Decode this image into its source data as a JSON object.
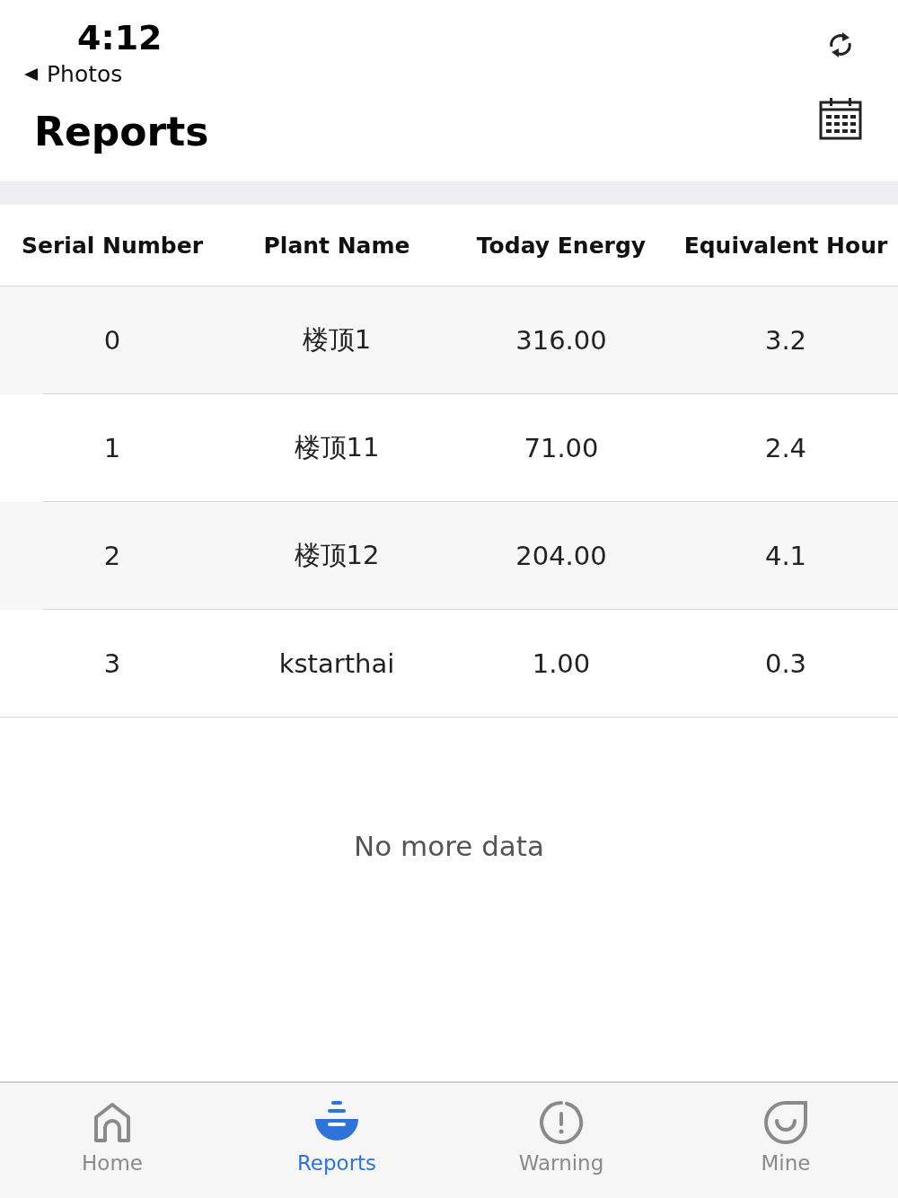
{
  "status_bar": {
    "time": "4:12",
    "back_label": "Photos"
  },
  "header": {
    "title": "Reports"
  },
  "table": {
    "columns": [
      "Serial Number",
      "Plant Name",
      "Today Energy",
      "Equivalent Hour"
    ],
    "rows": [
      {
        "cells": [
          "0",
          "楼顶1",
          "316.00",
          "3.2"
        ]
      },
      {
        "cells": [
          "1",
          "楼顶11",
          "71.00",
          "2.4"
        ]
      },
      {
        "cells": [
          "2",
          "楼顶12",
          "204.00",
          "4.1"
        ]
      },
      {
        "cells": [
          "3",
          "kstarthai",
          "1.00",
          "0.3"
        ]
      }
    ]
  },
  "footer_note": "No more data",
  "tab_bar": [
    {
      "label": "Home",
      "selected": false
    },
    {
      "label": "Reports",
      "selected": true
    },
    {
      "label": "Warning",
      "selected": false
    },
    {
      "label": "Mine",
      "selected": false
    }
  ]
}
